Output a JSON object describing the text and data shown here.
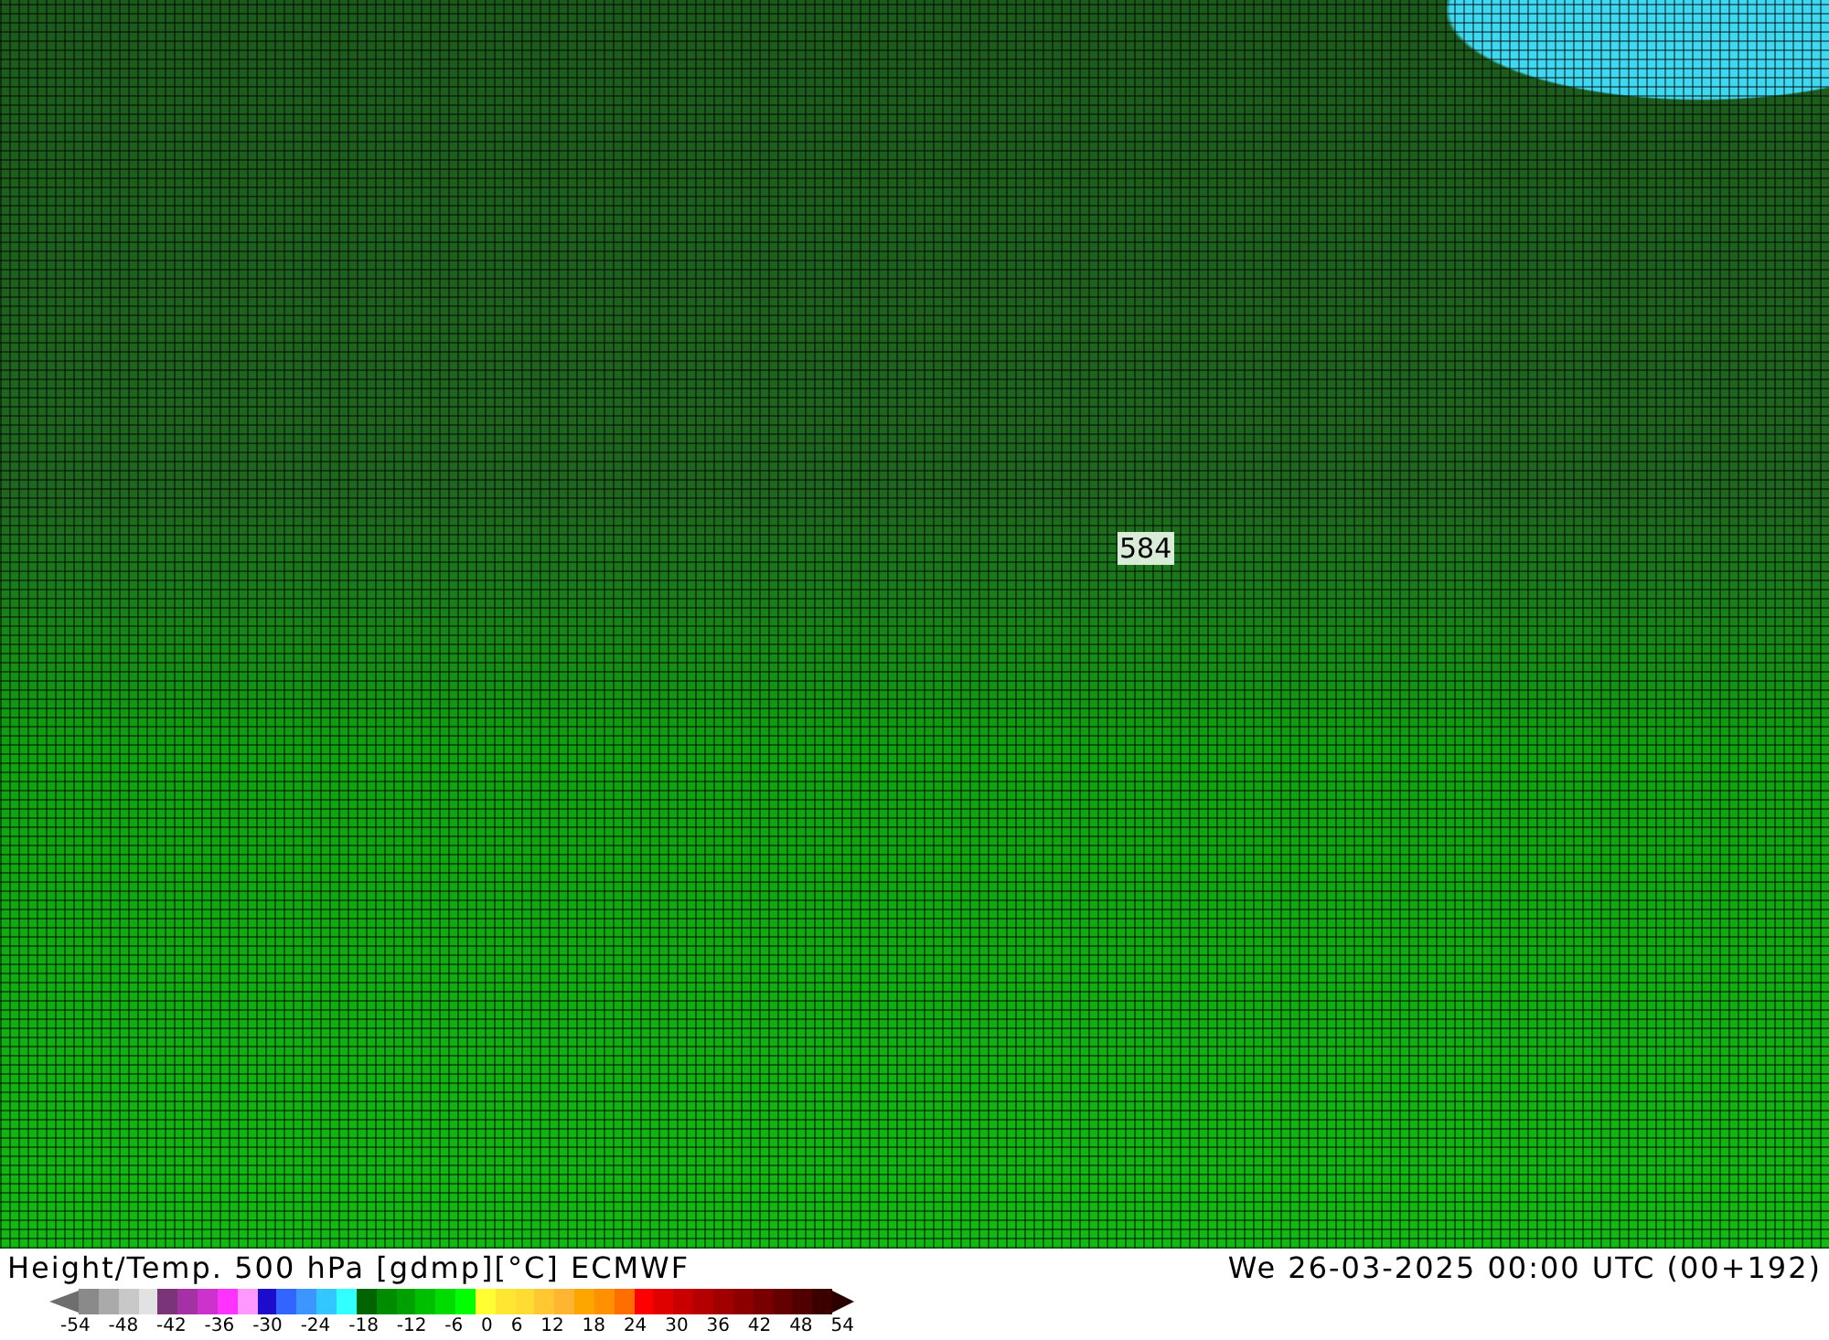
{
  "map": {
    "contour_labels": [
      {
        "text": "584"
      }
    ]
  },
  "footer": {
    "title": "Height/Temp. 500 hPa [gdmp][°C] ECMWF",
    "valid_time": "We 26-03-2025 00:00 UTC (00+192)"
  },
  "legend": {
    "swatches": [
      {
        "kind": "start",
        "color": "#6e6e6e"
      },
      {
        "color": "#8a8a8a"
      },
      {
        "color": "#aaaaaa"
      },
      {
        "color": "#c8c8c8"
      },
      {
        "color": "#e2e2e2"
      },
      {
        "color": "#7a3478"
      },
      {
        "color": "#a532a5"
      },
      {
        "color": "#cc33cc"
      },
      {
        "color": "#ff33ff"
      },
      {
        "color": "#ff99ff"
      },
      {
        "color": "#1e0ccc"
      },
      {
        "color": "#3264ff"
      },
      {
        "color": "#3c96ff"
      },
      {
        "color": "#32c8ff"
      },
      {
        "color": "#32ffff"
      },
      {
        "color": "#006400"
      },
      {
        "color": "#008c00"
      },
      {
        "color": "#00a000"
      },
      {
        "color": "#00be00"
      },
      {
        "color": "#00dc00"
      },
      {
        "color": "#00ff00"
      },
      {
        "color": "#ffff32"
      },
      {
        "color": "#ffe632"
      },
      {
        "color": "#ffdc32"
      },
      {
        "color": "#ffc832"
      },
      {
        "color": "#ffb432"
      },
      {
        "color": "#ffa500"
      },
      {
        "color": "#ff9100"
      },
      {
        "color": "#ff6e00"
      },
      {
        "color": "#ff0000"
      },
      {
        "color": "#e10000"
      },
      {
        "color": "#c80000"
      },
      {
        "color": "#b40000"
      },
      {
        "color": "#a00000"
      },
      {
        "color": "#8c0000"
      },
      {
        "color": "#780000"
      },
      {
        "color": "#640000"
      },
      {
        "color": "#500000"
      },
      {
        "color": "#3c0000"
      },
      {
        "kind": "end",
        "color": "#2a0000"
      }
    ],
    "labels": [
      "-54",
      "-48",
      "-42",
      "-36",
      "-30",
      "-24",
      "-18",
      "-12",
      "-6",
      "0",
      "6",
      "12",
      "18",
      "24",
      "30",
      "36",
      "42",
      "48",
      "54"
    ]
  }
}
